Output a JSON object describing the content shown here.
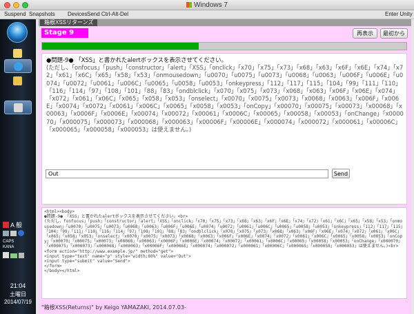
{
  "window": {
    "title": "Windows 7"
  },
  "toolbar": {
    "suspend": "Suspend",
    "snapshots": "Snapshots",
    "devices": "Devices",
    "send_cad": "Send Ctrl-Alt-Del",
    "enter_unity": "Enter Unity"
  },
  "taskbar": {
    "tray_label_1": "CAPS",
    "tray_label_2": "KANA",
    "clock_time": "21:04",
    "clock_day": "土曜日",
    "clock_date": "2014/07/19",
    "ime_text": "A 般"
  },
  "app": {
    "tab_title": "箱根XSSリターンズ",
    "stage": "Stage 9",
    "redisplay_label": "再表示",
    "restart_label": "最初から",
    "progress": 0.43,
    "problem_lead": "●問題-9● 「XSS」と書かれたalertボックスを表示させてください。",
    "problem_body": "(ただし、「onfocus」「push」「constructor」「alert」「XSS」「onclick」「x70」「x75」「x73」「x68」「x63」「x6F」「x6E」「x74」「x72」「x61」「x6C」「x65」「x58」「x53」「onmousedown」「u0070」「u0075」「u0073」「u0068」「u0063」「u006F」「u006E」「u0074」「u0072」「u0061」「u006C」「u0065」「u0058」「u0053」「onkeypress」「112」「117」「115」「104」「99」「111」「110」「116」「114」「97」「108」「101」「88」「83」「ondblclick」「x070」「x075」「x073」「x068」「x063」「x06F」「x06E」「x074」「x072」「x061」「x06C」「x065」「x058」「x053」「onselect」「x0070」「x0075」「x0073」「x0068」「x0063」「x006F」「x006E」「x0074」「x0072」「x0061」「x006C」「x0065」「x0058」「x0053」「onCopy」「x00070」「x00075」「x00073」「x00068」「x00063」「x0006F」「x0006E」「x00074」「x00072」「x00061」「x0006C」「x00065」「x00058」「x00053」「onChange」「x000070」「x000075」「x000073」「x000068」「x000063」「x00006F」「x00006E」「x000074」「x000072」「x000061」「x00006C」「x000065」「x000058」「x000053」は使えません。)",
    "answer_value": "Out",
    "send_label": "Send",
    "source_code": "<html><body>\n●問題-9● 「XSS」と書かれたalertボックスを表示させてください。<br>\n(ただし、fonfocus」「push」「constructor」「alert」「XSS」「onclick」「x70」「x75」「x73」「x68」「x63」「x6F」「x6E」「x74」「x72」「x61」「x6C」「x65」「x58」「x53」「onmousedown」「u0070」「u0075」「u0073」「u0068」「u0063」「u006F」「u006E」「u0074」「u0072」「u0061」「u006C」「u0065」「u0058」「u0053」「onkeypress」「112」「117」「115」「104」「99」「111」「110」「116」「114」「97」「108」「101」「88」「83」「ondblclick」「x070」「x075」「x073」「x068」「x063」「x06F」「x06E」「x074」「x072」「x061」「x06C」「x065」「x058」「x053」「onselect」「x0070」「x0075」「x0073」「x0068」「x0063」「x006F」「x006E」「x0074」「x0072」「x0061」「x006C」「x0065」「x0058」「x0053」「onCopy」「x00070」「x00075」「x00073」「x00068」「x00063」「x0006F」「x0006E」「x00074」「x00072」「x00061」「x0006C」「x00065」「x00058」「x00053」「onChange」「x000070」「x000075」「x000073」「x000068」「x000063」「x00006F」「x00006E」「x000074」「x000072」「x000061」「x00006C」「x000065」「x000058」「x000053」は使えません。)<br>\n<form action=\"http://www.example.jp/\" method=\"get\">\n<input type=\"text\" name=\"p\" style=\"width:80%\" value=\"Out\">\n<input type=\"submit\" value=\"Send\">\n</form>\n</body></html>",
    "footer": "\"箱根XSS(Returns)\" by Keigo YAMAZAKI, 2014.07.03-"
  },
  "colors": {
    "stage_bg": "#ff00ff",
    "frame_bg": "#ffd1ff",
    "progress_fill": "#00aa00"
  }
}
